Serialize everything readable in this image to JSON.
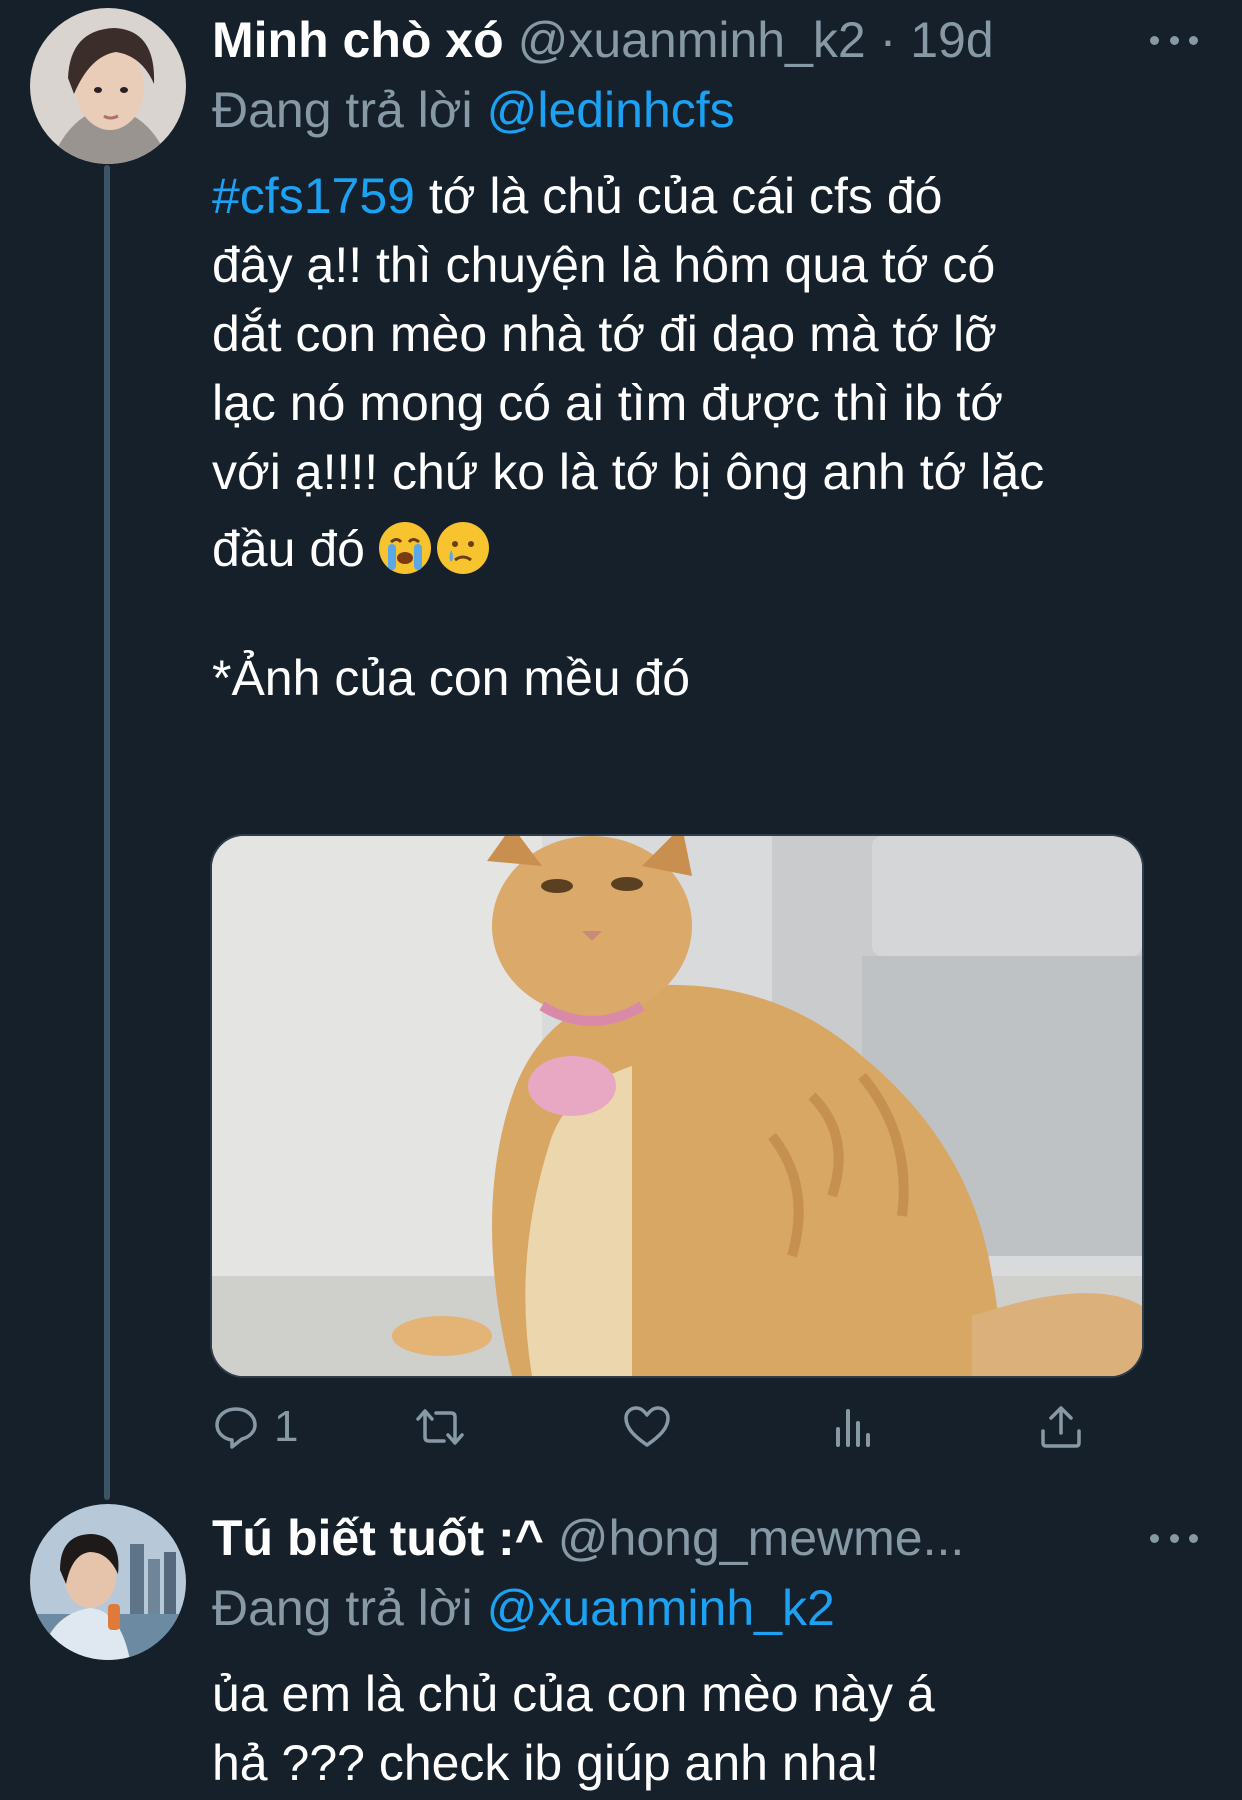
{
  "tweets": [
    {
      "display_name": "Minh chò xó",
      "handle": "@xuanminh_k2",
      "separator": "·",
      "time": "19d",
      "reply_prefix": "Đang trả lời",
      "reply_to": "@ledinhcfs",
      "hashtag": "#cfs1759",
      "text_lines": [
        " tớ là chủ của cái cfs đó",
        "đây ạ!! thì chuyện là hôm qua tớ có",
        "dắt con mèo nhà tớ đi dạo mà tớ lỡ",
        "lạc nó mong có ai tìm được thì ib tớ",
        "với ạ!!!! chứ ko là tớ bị ông anh tớ lặc",
        "đầu đó"
      ],
      "emojis": [
        "loudly-crying-face",
        "crying-face"
      ],
      "caption": "*Ảnh của con mều đó",
      "reply_count": "1",
      "actions": [
        "reply-icon",
        "retweet-icon",
        "like-icon",
        "analytics-icon",
        "share-icon"
      ]
    },
    {
      "display_name": "Tú biết tuốt :^",
      "handle": "@hong_mewme...",
      "reply_prefix": "Đang trả lời",
      "reply_to": "@xuanminh_k2",
      "text_lines": [
        "ủa em là chủ của con mèo này á",
        "hả ??? check ib giúp anh nha!"
      ]
    }
  ],
  "colors": {
    "background": "#15202b",
    "text": "#ffffff",
    "secondary": "#8899a6",
    "accent": "#1da1f2",
    "thread_line": "#3d5466"
  }
}
